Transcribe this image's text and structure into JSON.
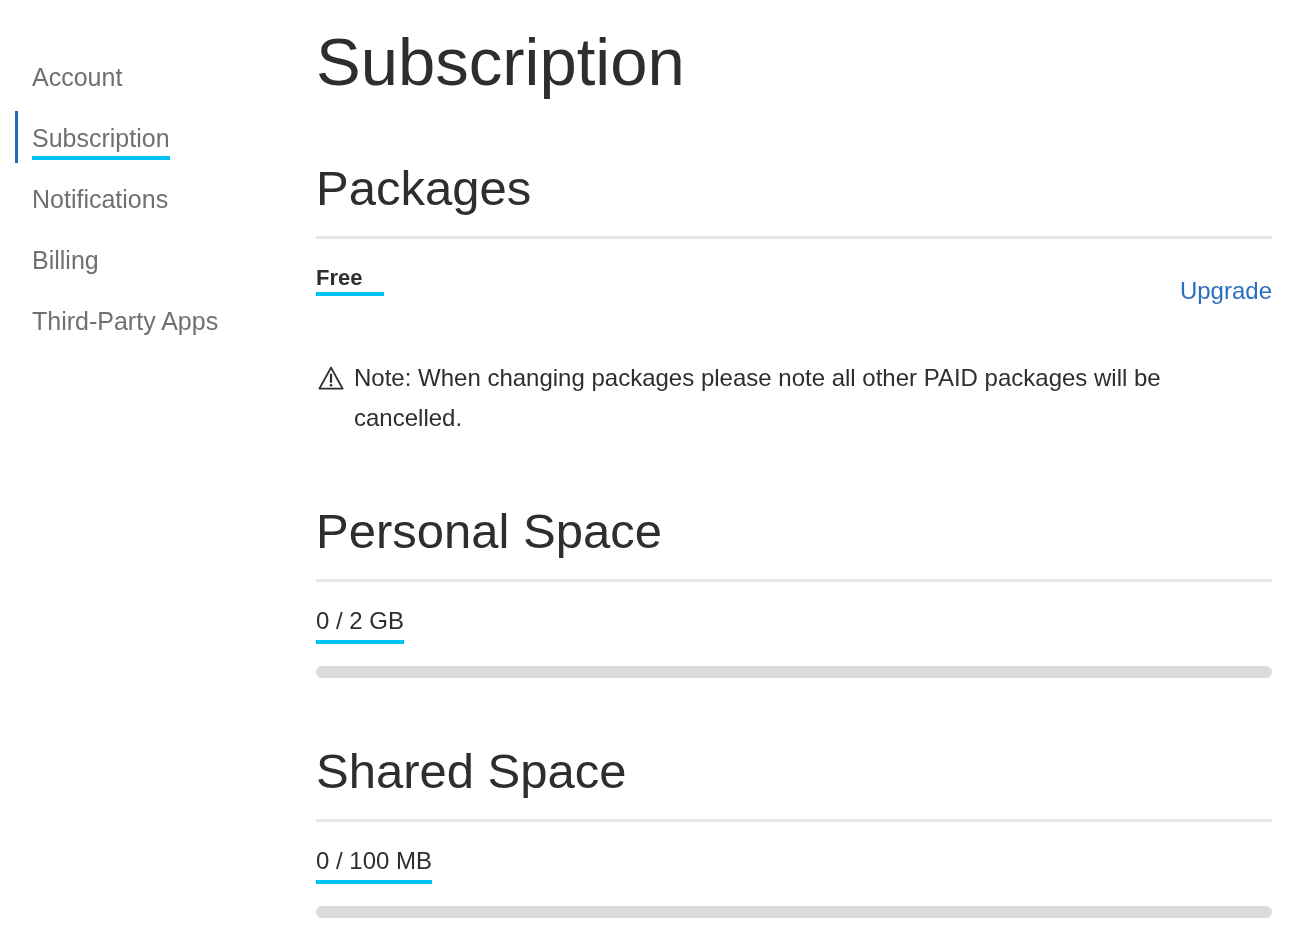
{
  "sidebar": {
    "items": [
      {
        "label": "Account",
        "selected": false
      },
      {
        "label": "Subscription",
        "selected": true
      },
      {
        "label": "Notifications",
        "selected": false
      },
      {
        "label": "Billing",
        "selected": false
      },
      {
        "label": "Third-Party Apps",
        "selected": false
      }
    ]
  },
  "page_title": "Subscription",
  "sections": [
    {
      "kind": "packages",
      "heading": "Packages",
      "plan": "Free",
      "action": "Upgrade",
      "note": "Note: When changing packages please note all other PAID packages will be cancelled."
    },
    {
      "kind": "usage",
      "heading": "Personal Space",
      "usage": "0 / 2 GB",
      "level": 0
    },
    {
      "kind": "usage",
      "heading": "Shared Space",
      "usage": "0 / 100 MB",
      "level": 0
    }
  ]
}
